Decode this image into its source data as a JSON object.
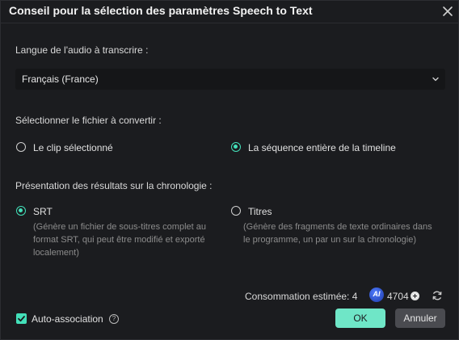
{
  "dialog": {
    "title": "Conseil pour la sélection des paramètres Speech to Text",
    "close_icon": "close-icon"
  },
  "language": {
    "label": "Langue de l'audio à transcrire :",
    "selected": "Français (France)"
  },
  "source": {
    "label": "Sélectionner le fichier à convertir :",
    "options": [
      {
        "label": "Le clip sélectionné",
        "selected": false
      },
      {
        "label": "La séquence entière de la timeline",
        "selected": true
      }
    ]
  },
  "output": {
    "label": "Présentation des résultats sur la chronologie :",
    "options": [
      {
        "label": "SRT",
        "selected": true,
        "description": "(Génère un fichier de sous-titres complet au format SRT, qui peut être modifié et exporté localement)"
      },
      {
        "label": "Titres",
        "selected": false,
        "description": "(Génère des fragments de texte ordinaires dans le programme, un par un sur la chronologie)"
      }
    ]
  },
  "footer": {
    "cost_label": "Consommation estimée: 4",
    "ai_badge": "AI",
    "credits": "4704",
    "auto_association": "Auto-association",
    "auto_association_checked": true,
    "help": "?",
    "ok_label": "OK",
    "cancel_label": "Annuler"
  },
  "colors": {
    "accent": "#43e0b9",
    "ok_button": "#6fe6c7",
    "background": "#1b1c1f"
  }
}
